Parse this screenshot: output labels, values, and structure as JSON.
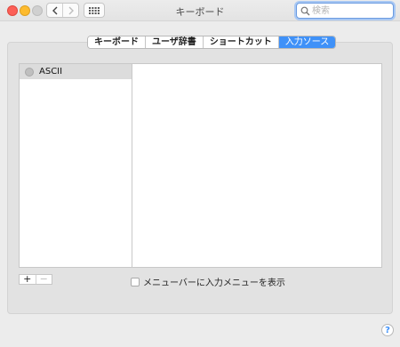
{
  "window": {
    "title": "キーボード"
  },
  "search": {
    "placeholder": "検索"
  },
  "tabs": [
    {
      "label": "キーボード",
      "active": false
    },
    {
      "label": "ユーザ辞書",
      "active": false
    },
    {
      "label": "ショートカット",
      "active": false
    },
    {
      "label": "入力ソース",
      "active": true
    }
  ],
  "input_sources": [
    {
      "label": "ASCII",
      "selected": true
    }
  ],
  "controls": {
    "add_label": "+",
    "remove_label": "−",
    "show_menu_label": "メニューバーに入力メニューを表示",
    "show_menu_checked": false,
    "help_label": "?"
  },
  "colors": {
    "accent": "#3f91f8",
    "close": "#fc5f57",
    "minimize": "#fdbb2e",
    "zoom_disabled": "#d0d0d0"
  }
}
